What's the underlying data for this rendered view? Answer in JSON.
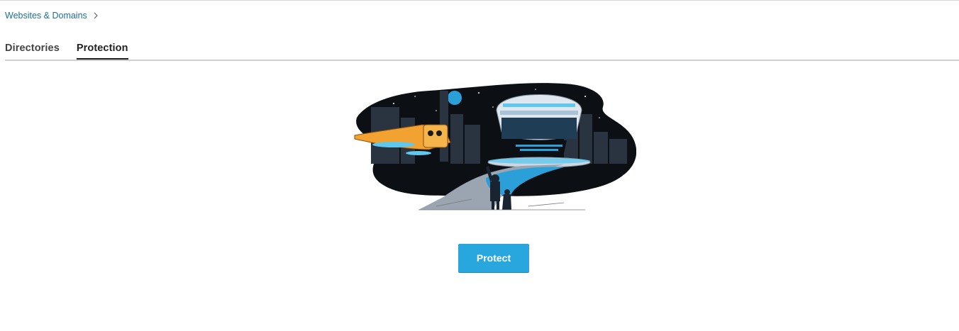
{
  "breadcrumb": {
    "items": [
      {
        "label": "Websites & Domains",
        "icon": "chevron-right-icon"
      }
    ]
  },
  "tabs": [
    {
      "label": "Directories",
      "active": false
    },
    {
      "label": "Protection",
      "active": true
    }
  ],
  "illustration": {
    "icon": "space-city-illustration"
  },
  "actions": {
    "protect_label": "Protect"
  },
  "colors": {
    "link": "#1e6f9a",
    "primary_button": "#28a7df",
    "tab_underline": "#222222",
    "divider": "#cfcfcf"
  }
}
